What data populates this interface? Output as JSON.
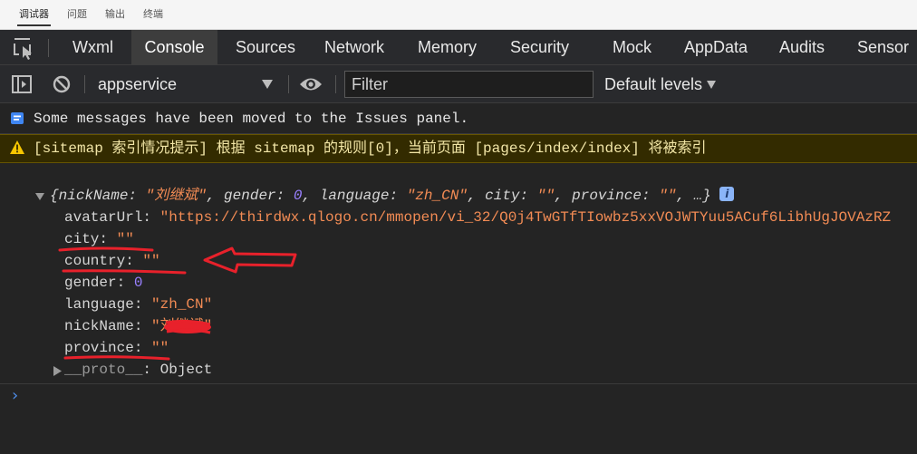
{
  "top_tabs": [
    {
      "label": "调试器",
      "active": true
    },
    {
      "label": "问题",
      "active": false
    },
    {
      "label": "输出",
      "active": false
    },
    {
      "label": "终端",
      "active": false
    }
  ],
  "panel_tabs": {
    "items": [
      {
        "label": "Wxml"
      },
      {
        "label": "Console"
      },
      {
        "label": "Sources"
      },
      {
        "label": "Network"
      },
      {
        "label": "Memory"
      },
      {
        "label": "Security"
      },
      {
        "label": "Mock"
      },
      {
        "label": "AppData"
      },
      {
        "label": "Audits"
      },
      {
        "label": "Sensor"
      }
    ],
    "active": "Console"
  },
  "toolbar": {
    "context": "appservice",
    "filter_placeholder": "Filter",
    "levels": "Default levels"
  },
  "messages": {
    "info": "Some messages have been moved to the Issues panel.",
    "warning": "[sitemap 索引情况提示] 根据 sitemap 的规则[0]，当前页面 [pages/index/index] 将被索引"
  },
  "log_object": {
    "summary": {
      "open": "{",
      "nickName_key": "nickName",
      "nickName_value": "\"刘继斌\"",
      "gender_key": "gender",
      "gender_value": "0",
      "language_key": "language",
      "language_value": "\"zh_CN\"",
      "city_key": "city",
      "city_value": "\"\"",
      "province_key": "province",
      "province_value": "\"\"",
      "ellipsis": "…}"
    },
    "properties": [
      {
        "key": "avatarUrl",
        "value": "\"https://thirdwx.qlogo.cn/mmopen/vi_32/Q0j4TwGTfTIowbz5xxVOJWTYuu5ACuf6LibhUgJOVAzRZ",
        "type": "string"
      },
      {
        "key": "city",
        "value": "\"\"",
        "type": "string"
      },
      {
        "key": "country",
        "value": "\"\"",
        "type": "string"
      },
      {
        "key": "gender",
        "value": "0",
        "type": "number"
      },
      {
        "key": "language",
        "value": "\"zh_CN\"",
        "type": "string"
      },
      {
        "key": "nickName",
        "value": "\"刘继斌\"",
        "type": "string"
      },
      {
        "key": "province",
        "value": "\"\"",
        "type": "string"
      }
    ],
    "proto": {
      "key": "__proto__",
      "value": "Object"
    }
  },
  "prompt": "›",
  "colors": {
    "annotation_red": "#e8212b",
    "string": "#f28b54",
    "number": "#9980ff",
    "prompt": "#4e8de8"
  },
  "icons": [
    "inspect-element-icon",
    "sidebar-toggle-icon",
    "clear-console-icon",
    "eye-icon",
    "info-message-icon",
    "warning-triangle-icon",
    "expand-triangle-icon",
    "collapse-triangle-icon",
    "info-badge-icon"
  ]
}
